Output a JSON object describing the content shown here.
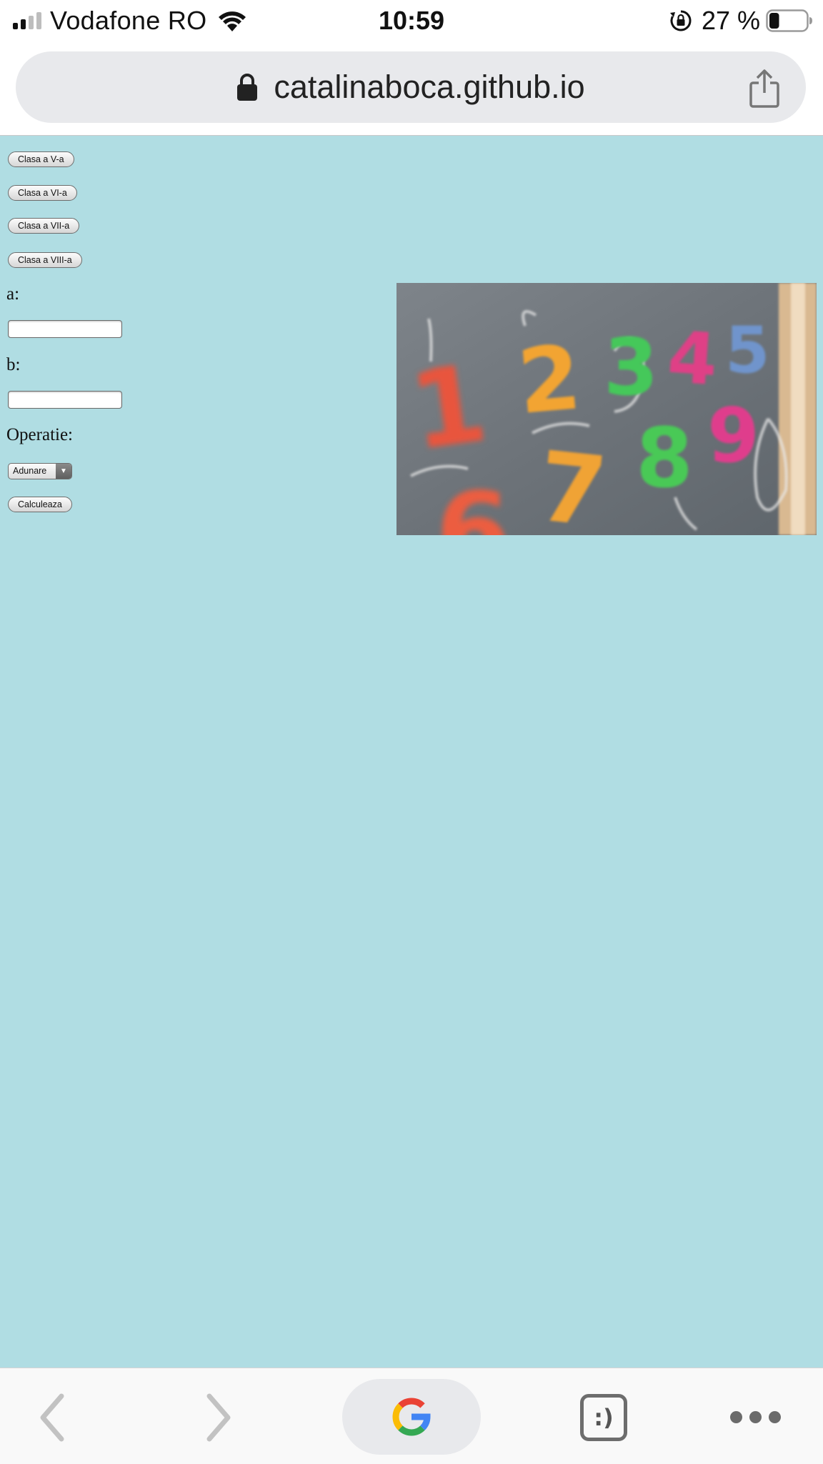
{
  "status_bar": {
    "carrier": "Vodafone RO",
    "time": "10:59",
    "battery_percent": "27 %",
    "battery_level": 0.27
  },
  "browser": {
    "url": "catalinaboca.github.io"
  },
  "page": {
    "background_color": "#b0dde3",
    "class_buttons": [
      {
        "label": "Clasa a V-a"
      },
      {
        "label": "Clasa a VI-a"
      },
      {
        "label": "Clasa a VII-a"
      },
      {
        "label": "Clasa a VIII-a"
      }
    ],
    "form": {
      "label_a": "a:",
      "value_a": "",
      "label_b": "b:",
      "value_b": "",
      "operation_label": "Operatie:",
      "operation_selected": "Adunare",
      "submit_label": "Calculeaza"
    },
    "image": {
      "digits": [
        "1",
        "2",
        "3",
        "4",
        "5",
        "6",
        "7",
        "8",
        "9"
      ]
    }
  },
  "toolbar": {
    "tabs_label": ":)"
  }
}
